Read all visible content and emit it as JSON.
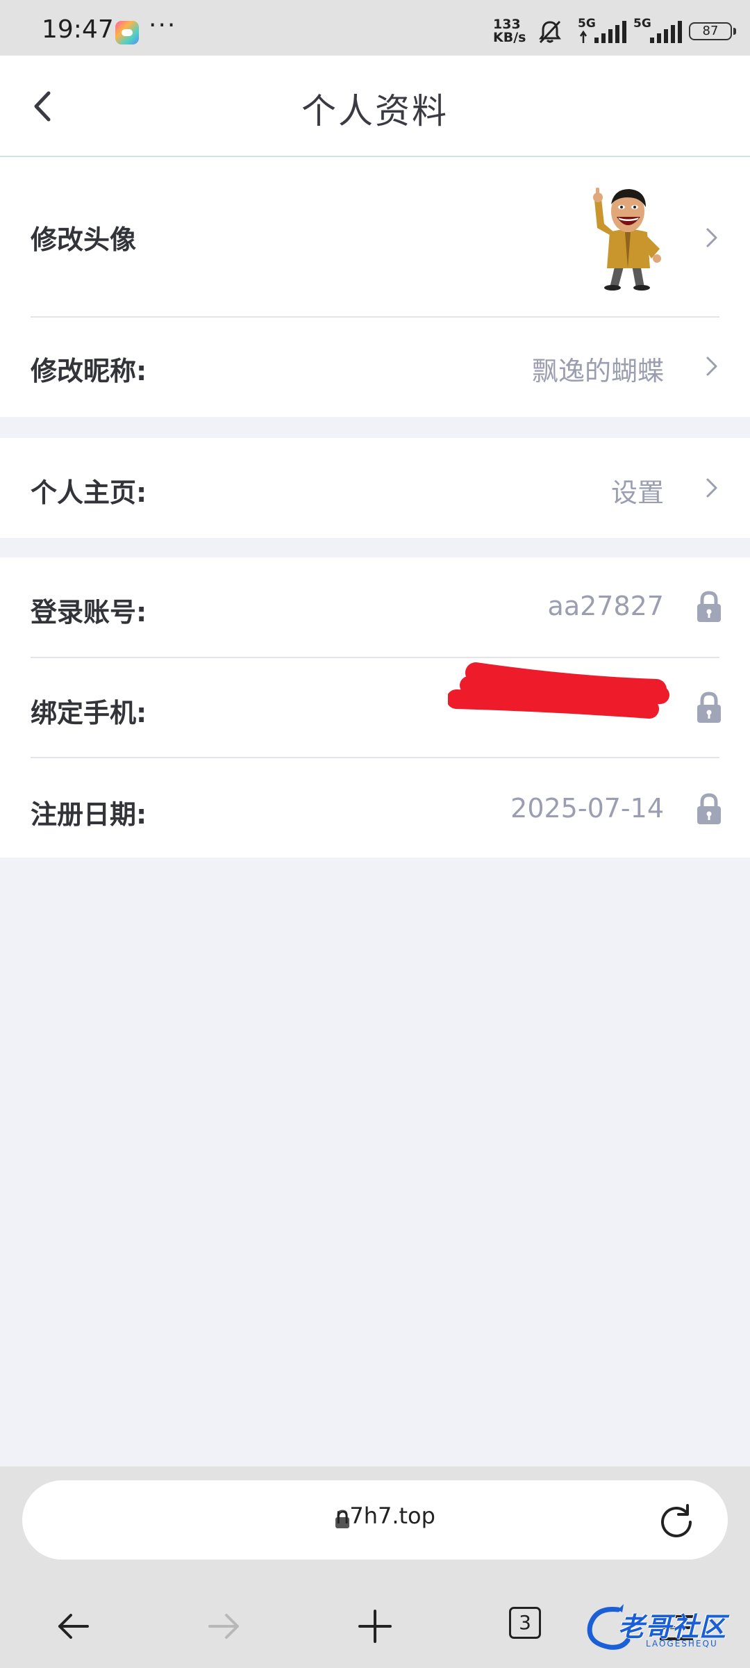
{
  "status_bar": {
    "time": "19:47",
    "net_speed_value": "133",
    "net_speed_unit": "KB/s",
    "network_1": "5G",
    "network_2": "5G",
    "battery": "87"
  },
  "header": {
    "title": "个人资料"
  },
  "profile": {
    "avatar_label": "修改头像",
    "nickname_label": "修改昵称:",
    "nickname_value": "飘逸的蝴蝶",
    "homepage_label": "个人主页:",
    "homepage_value": "设置",
    "account_label": "登录账号:",
    "account_value": "aa27827",
    "phone_label": "绑定手机:",
    "phone_value": "",
    "register_label": "注册日期:",
    "register_value": "2025-07-14"
  },
  "browser": {
    "url": "n7h7.top",
    "tab_count": "3"
  },
  "watermark": {
    "text": "老哥社区",
    "sub": "LAOGESHEQU"
  },
  "colors": {
    "background": "#f0f2f7",
    "value_text": "#9a9eb0",
    "lock_icon": "#a1a5b8",
    "redaction": "#ee1c2b"
  }
}
